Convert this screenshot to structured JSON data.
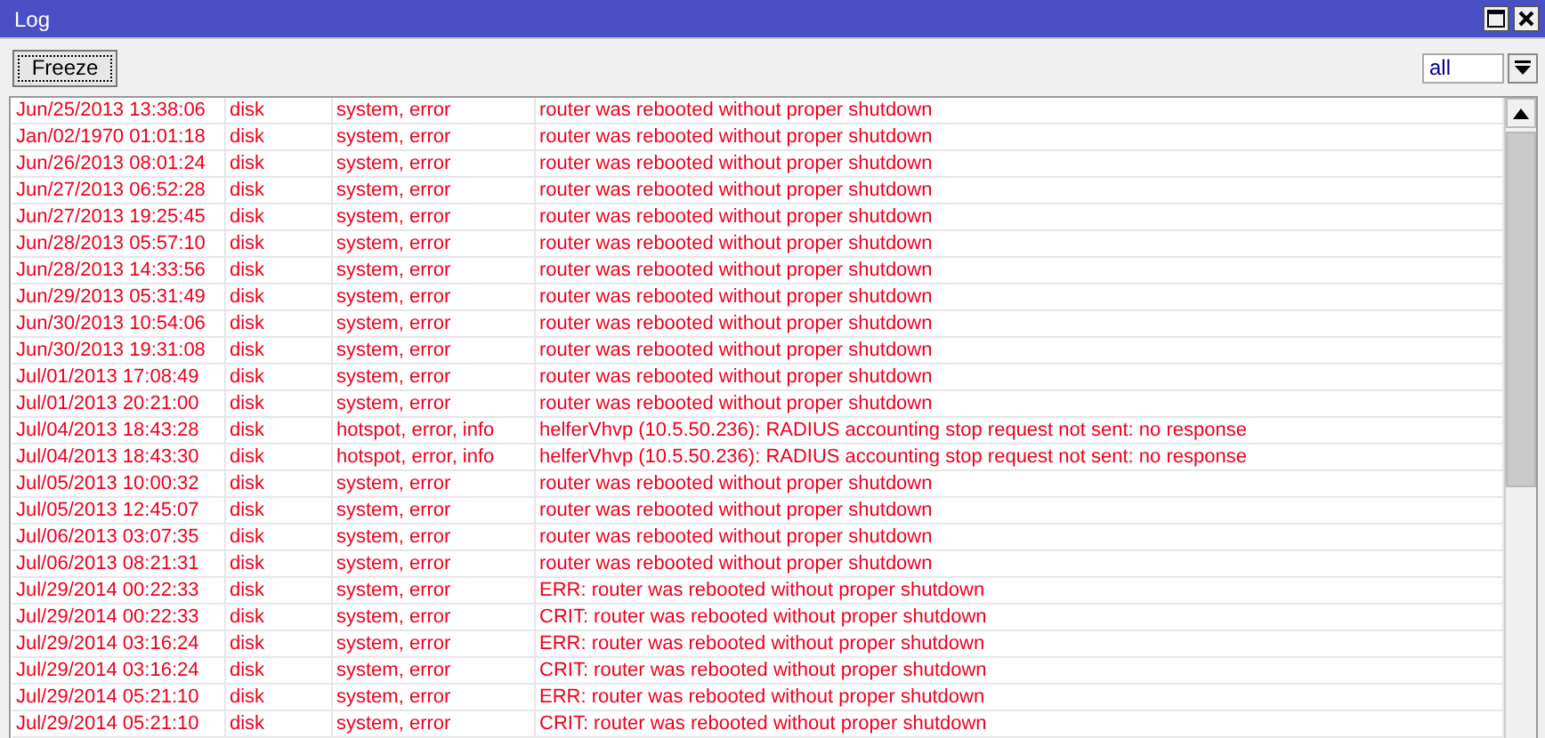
{
  "window": {
    "title": "Log"
  },
  "toolbar": {
    "freeze_button": "Freeze",
    "filter": {
      "value": "all"
    }
  },
  "rows": [
    {
      "time": "Jun/25/2013 13:38:06",
      "column_2": "disk",
      "topics": "system, error",
      "message": "router was rebooted without proper shutdown"
    },
    {
      "time": "Jan/02/1970 01:01:18",
      "column_2": "disk",
      "topics": "system, error",
      "message": "router was rebooted without proper shutdown"
    },
    {
      "time": "Jun/26/2013 08:01:24",
      "column_2": "disk",
      "topics": "system, error",
      "message": "router was rebooted without proper shutdown"
    },
    {
      "time": "Jun/27/2013 06:52:28",
      "column_2": "disk",
      "topics": "system, error",
      "message": "router was rebooted without proper shutdown"
    },
    {
      "time": "Jun/27/2013 19:25:45",
      "column_2": "disk",
      "topics": "system, error",
      "message": "router was rebooted without proper shutdown"
    },
    {
      "time": "Jun/28/2013 05:57:10",
      "column_2": "disk",
      "topics": "system, error",
      "message": "router was rebooted without proper shutdown"
    },
    {
      "time": "Jun/28/2013 14:33:56",
      "column_2": "disk",
      "topics": "system, error",
      "message": "router was rebooted without proper shutdown"
    },
    {
      "time": "Jun/29/2013 05:31:49",
      "column_2": "disk",
      "topics": "system, error",
      "message": "router was rebooted without proper shutdown"
    },
    {
      "time": "Jun/30/2013 10:54:06",
      "column_2": "disk",
      "topics": "system, error",
      "message": "router was rebooted without proper shutdown"
    },
    {
      "time": "Jun/30/2013 19:31:08",
      "column_2": "disk",
      "topics": "system, error",
      "message": "router was rebooted without proper shutdown"
    },
    {
      "time": "Jul/01/2013 17:08:49",
      "column_2": "disk",
      "topics": "system, error",
      "message": "router was rebooted without proper shutdown"
    },
    {
      "time": "Jul/01/2013 20:21:00",
      "column_2": "disk",
      "topics": "system, error",
      "message": "router was rebooted without proper shutdown"
    },
    {
      "time": "Jul/04/2013 18:43:28",
      "column_2": "disk",
      "topics": "hotspot, error, info",
      "message": "helferVhvp (10.5.50.236): RADIUS accounting stop request not sent: no response"
    },
    {
      "time": "Jul/04/2013 18:43:30",
      "column_2": "disk",
      "topics": "hotspot, error, info",
      "message": "helferVhvp (10.5.50.236): RADIUS accounting stop request not sent: no response"
    },
    {
      "time": "Jul/05/2013 10:00:32",
      "column_2": "disk",
      "topics": "system, error",
      "message": "router was rebooted without proper shutdown"
    },
    {
      "time": "Jul/05/2013 12:45:07",
      "column_2": "disk",
      "topics": "system, error",
      "message": "router was rebooted without proper shutdown"
    },
    {
      "time": "Jul/06/2013 03:07:35",
      "column_2": "disk",
      "topics": "system, error",
      "message": "router was rebooted without proper shutdown"
    },
    {
      "time": "Jul/06/2013 08:21:31",
      "column_2": "disk",
      "topics": "system, error",
      "message": "router was rebooted without proper shutdown"
    },
    {
      "time": "Jul/29/2014 00:22:33",
      "column_2": "disk",
      "topics": "system, error",
      "message": "ERR: router was rebooted without proper shutdown"
    },
    {
      "time": "Jul/29/2014 00:22:33",
      "column_2": "disk",
      "topics": "system, error",
      "message": "CRIT: router was rebooted without proper shutdown"
    },
    {
      "time": "Jul/29/2014 03:16:24",
      "column_2": "disk",
      "topics": "system, error",
      "message": "ERR: router was rebooted without proper shutdown"
    },
    {
      "time": "Jul/29/2014 03:16:24",
      "column_2": "disk",
      "topics": "system, error",
      "message": "CRIT: router was rebooted without proper shutdown"
    },
    {
      "time": "Jul/29/2014 05:21:10",
      "column_2": "disk",
      "topics": "system, error",
      "message": "ERR: router was rebooted without proper shutdown"
    },
    {
      "time": "Jul/29/2014 05:21:10",
      "column_2": "disk",
      "topics": "system, error",
      "message": "CRIT: router was rebooted without proper shutdown"
    }
  ]
}
